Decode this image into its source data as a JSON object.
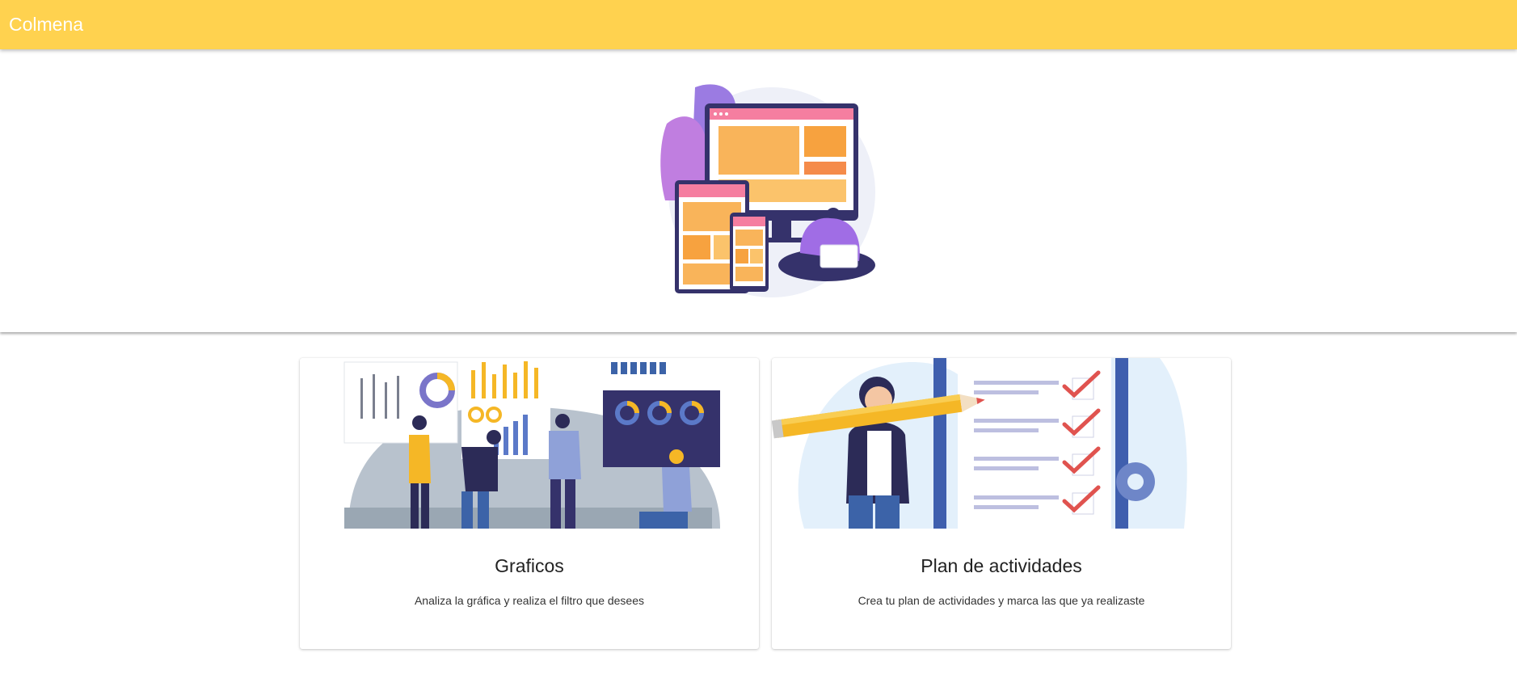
{
  "app": {
    "title": "Colmena"
  },
  "hero": {
    "illustration": "responsive-devices-illustration"
  },
  "cards": [
    {
      "title": "Graficos",
      "description": "Analiza la gráfica y realiza el filtro que desees",
      "illustration": "data-analysis-team-illustration"
    },
    {
      "title": "Plan de actividades",
      "description": "Crea tu plan de actividades y marca las que ya realizaste",
      "illustration": "task-checklist-illustration"
    }
  ],
  "colors": {
    "toolbar": "#ffd24f",
    "accent_purple": "#9c6fe0",
    "accent_orange": "#f5a53a",
    "accent_navy": "#35326b",
    "check_red": "#e0534f"
  }
}
